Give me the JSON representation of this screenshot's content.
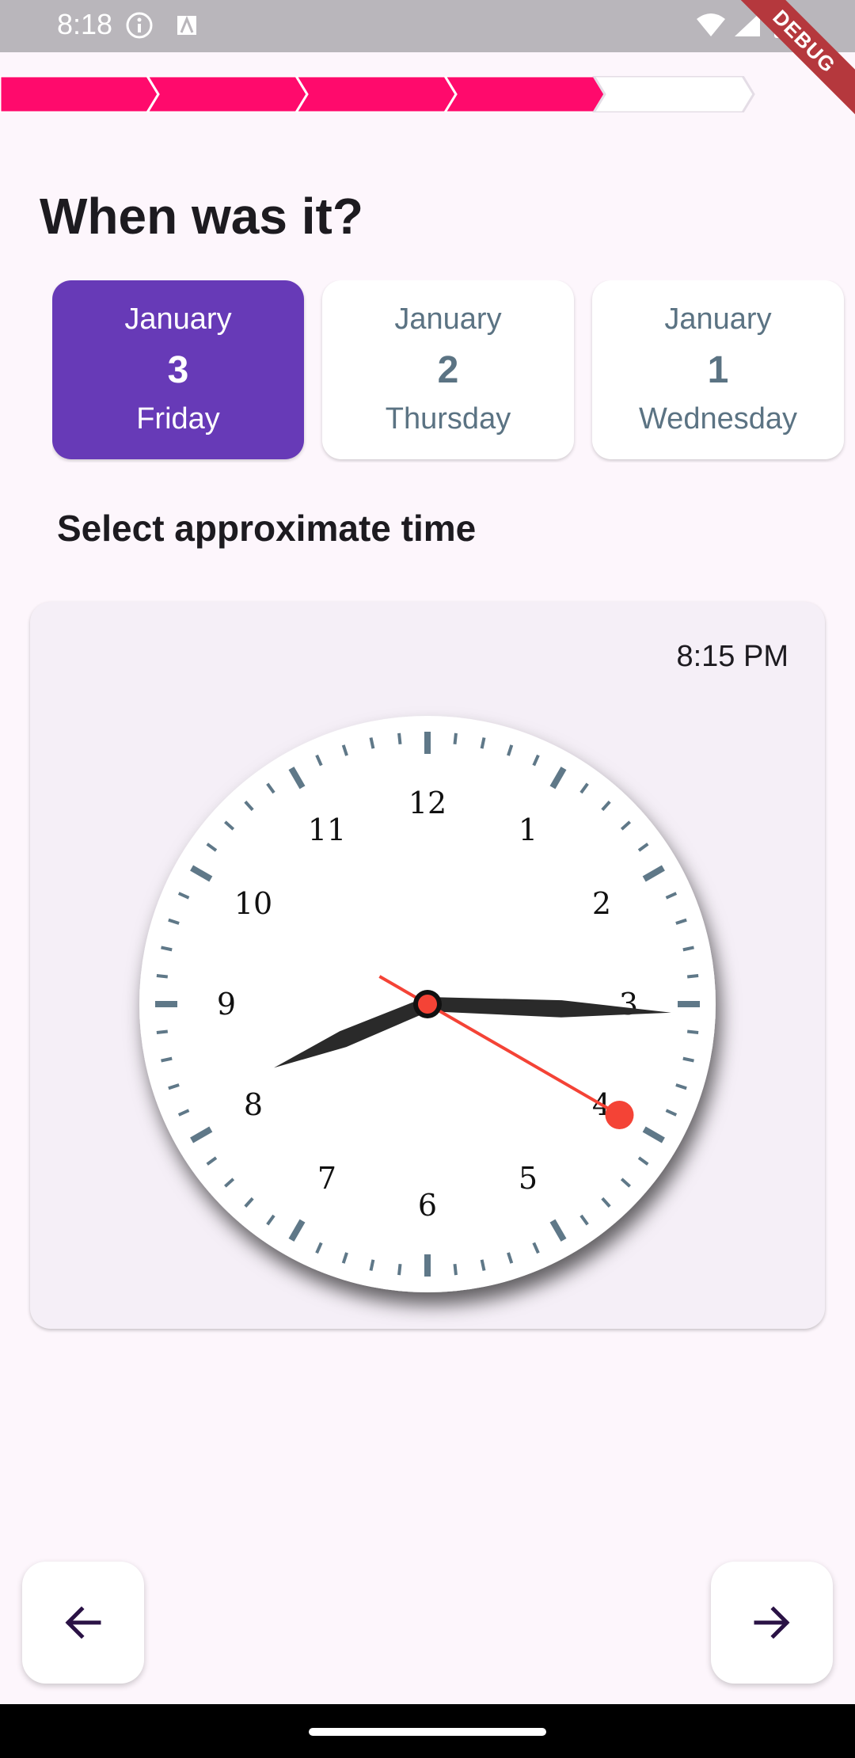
{
  "status_bar": {
    "time": "8:18",
    "left_icons": [
      "info-icon",
      "font-download-icon"
    ],
    "right_icons": [
      "wifi-icon",
      "signal-icon",
      "battery-icon"
    ],
    "debug_banner": "DEBUG"
  },
  "progress": {
    "total_steps": 5,
    "completed_steps": 4,
    "completed_color": "#ff0a6c",
    "pending_color": "#ffffff"
  },
  "header": {
    "title": "When was it?"
  },
  "dates": [
    {
      "month": "January",
      "day": "3",
      "weekday": "Friday",
      "selected": true
    },
    {
      "month": "January",
      "day": "2",
      "weekday": "Thursday",
      "selected": false
    },
    {
      "month": "January",
      "day": "1",
      "weekday": "Wednesday",
      "selected": false
    }
  ],
  "time_section": {
    "label": "Select approximate time",
    "selected_time": "8:15 PM"
  },
  "clock": {
    "numbers": [
      "12",
      "1",
      "2",
      "3",
      "4",
      "5",
      "6",
      "7",
      "8",
      "9",
      "10",
      "11"
    ],
    "hour": 8,
    "minute": 15,
    "second": 20,
    "hand_color": "#2a2a2a",
    "second_hand_color": "#f44336",
    "tick_color": "#5f7888"
  },
  "navigation": {
    "back_icon": "arrow-left-icon",
    "next_icon": "arrow-right-icon",
    "icon_color": "#2a1245"
  },
  "colors": {
    "accent": "#673ab7",
    "background": "#fdf6fc"
  }
}
